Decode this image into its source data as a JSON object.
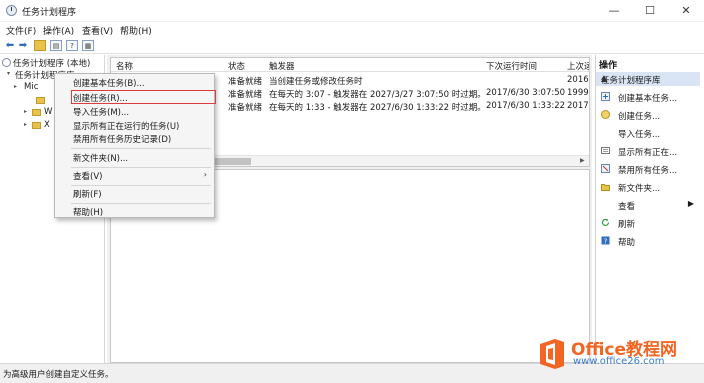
{
  "window": {
    "title": "任务计划程序",
    "minimize": "—",
    "maximize": "☐",
    "close": "✕"
  },
  "menubar": {
    "items": [
      "文件(F)",
      "操作(A)",
      "查看(V)",
      "帮助(H)"
    ]
  },
  "tree": {
    "root": "任务计划程序 (本地)",
    "library": "任务计划程序库",
    "children": [
      "Mic",
      "W",
      "X"
    ]
  },
  "grid": {
    "columns": [
      "名称",
      "状态",
      "触发器",
      "下次运行时间",
      "上次运"
    ],
    "rows": [
      {
        "name": "",
        "status": "准备就绪",
        "trigger": "当创建任务或修改任务时",
        "next_run": "",
        "last_run": "2016"
      },
      {
        "name": "",
        "status": "准备就绪",
        "trigger": "在每天的 3:07 - 触发器在 2027/3/27 3:07:50 时过期。",
        "next_run": "2017/6/30 3:07:50",
        "last_run": "1999"
      },
      {
        "name": "",
        "status": "准备就绪",
        "trigger": "在每天的 1:33 - 触发器在 2027/6/30 1:33:22 时过期。",
        "next_run": "2017/6/30 1:33:22",
        "last_run": "2017"
      }
    ]
  },
  "context_menu": {
    "items": [
      {
        "label": "创建基本任务(B)..."
      },
      {
        "label": "创建任务(R)...",
        "highlighted": true
      },
      {
        "label": "导入任务(M)..."
      },
      {
        "label": "显示所有正在运行的任务(U)"
      },
      {
        "label": "禁用所有任务历史记录(D)"
      },
      {
        "label": "新文件夹(N)..."
      },
      {
        "label": "查看(V)",
        "submenu_glyph": "›"
      },
      {
        "label": "刷新(F)"
      },
      {
        "label": "帮助(H)"
      }
    ]
  },
  "actions": {
    "title": "操作",
    "section": "任务计划程序库",
    "collapse_glyph": "▲",
    "items": [
      {
        "label": "创建基本任务...",
        "icon": "create-basic-task-icon"
      },
      {
        "label": "创建任务...",
        "icon": "create-task-icon"
      },
      {
        "label": "导入任务...",
        "icon": "import-icon"
      },
      {
        "label": "显示所有正在...",
        "icon": "running-tasks-icon"
      },
      {
        "label": "禁用所有任务...",
        "icon": "disable-history-icon"
      },
      {
        "label": "新文件夹...",
        "icon": "new-folder-icon"
      },
      {
        "label": "查看",
        "icon": "",
        "arrow": "▶"
      },
      {
        "label": "刷新",
        "icon": "refresh-icon"
      },
      {
        "label": "帮助",
        "icon": "help-icon"
      }
    ]
  },
  "status": {
    "text": "为高级用户创建自定义任务。"
  },
  "watermark": {
    "title": "Office教程网",
    "subtitle": "www.office26.com"
  },
  "colors": {
    "highlight_border": "#e0393e",
    "selection": "#cce4f7",
    "action_section": "#d9e5f4",
    "watermark_orange": "#f26522",
    "watermark_blue": "#3a7dc9"
  }
}
